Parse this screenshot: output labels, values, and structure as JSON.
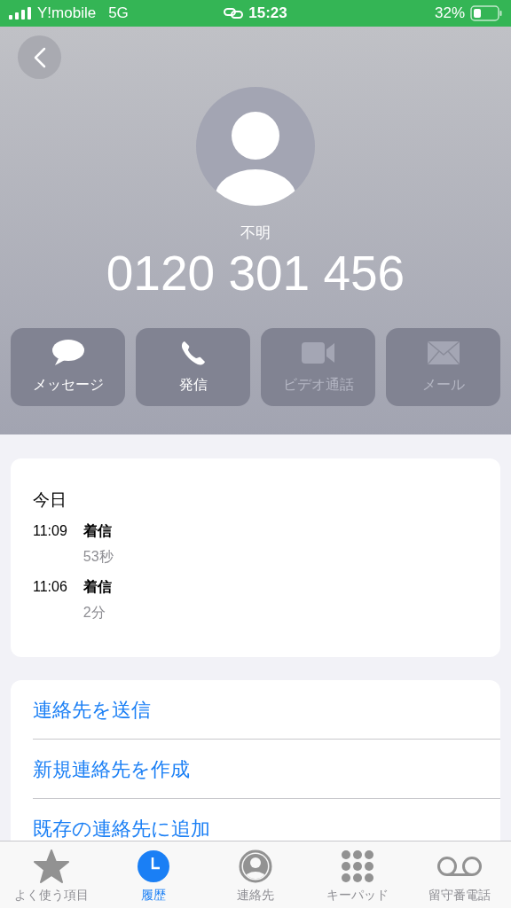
{
  "status_bar": {
    "carrier": "Y!mobile",
    "network": "5G",
    "time": "15:23",
    "battery": "32%"
  },
  "contact": {
    "label": "不明",
    "number": "0120 301 456"
  },
  "actions": [
    {
      "kind": "message",
      "label": "メッセージ",
      "disabled": false
    },
    {
      "kind": "call",
      "label": "発信",
      "disabled": false
    },
    {
      "kind": "video",
      "label": "ビデオ通話",
      "disabled": true
    },
    {
      "kind": "mail",
      "label": "メール",
      "disabled": true
    }
  ],
  "history": {
    "day": "今日",
    "calls": [
      {
        "time": "11:09",
        "type": "着信",
        "duration": "53秒"
      },
      {
        "time": "11:06",
        "type": "着信",
        "duration": "2分"
      }
    ]
  },
  "options": [
    "連絡先を送信",
    "新規連絡先を作成",
    "既存の連絡先に追加"
  ],
  "tabs": [
    {
      "kind": "star",
      "label": "よく使う項目",
      "selected": false
    },
    {
      "kind": "clock",
      "label": "履歴",
      "selected": true
    },
    {
      "kind": "person",
      "label": "連絡先",
      "selected": false
    },
    {
      "kind": "keypad",
      "label": "キーパッド",
      "selected": false
    },
    {
      "kind": "voicemail",
      "label": "留守番電話",
      "selected": false
    }
  ]
}
